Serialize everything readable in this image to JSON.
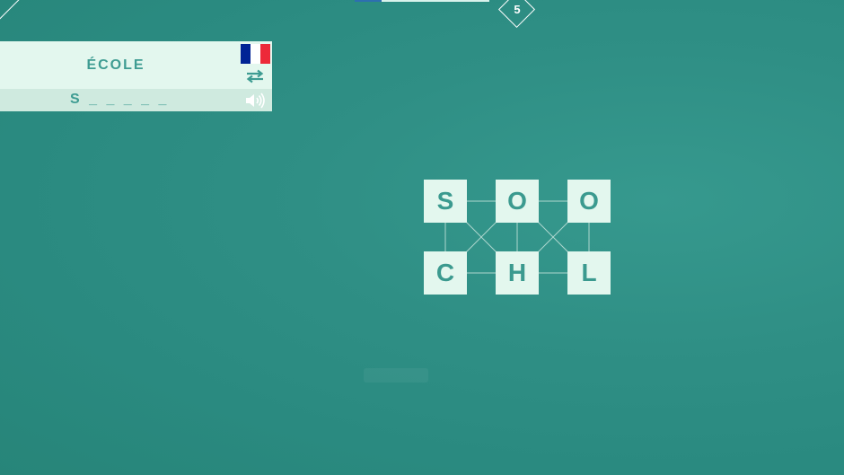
{
  "hud": {
    "level_number": "5",
    "progress_fraction": 0.2
  },
  "clue": {
    "word": "ÉCOLE",
    "hint": "S _ _ _ _ _",
    "language": "French",
    "flag_colors": [
      "#002395",
      "#ffffff",
      "#ed2939"
    ],
    "swap_icon": "swap-arrows-icon",
    "speaker_icon": "speaker-icon"
  },
  "board": {
    "tiles": [
      {
        "letter": "S"
      },
      {
        "letter": "O"
      },
      {
        "letter": "O"
      },
      {
        "letter": "C"
      },
      {
        "letter": "H"
      },
      {
        "letter": "L"
      }
    ]
  },
  "colors": {
    "background": "#2f8f85",
    "tile": "#e3f7ee",
    "tile_text": "#3b9a8f",
    "panel": "#e3f7ee",
    "panel_secondary": "#cfeadf",
    "accent": "#3e9c92"
  }
}
